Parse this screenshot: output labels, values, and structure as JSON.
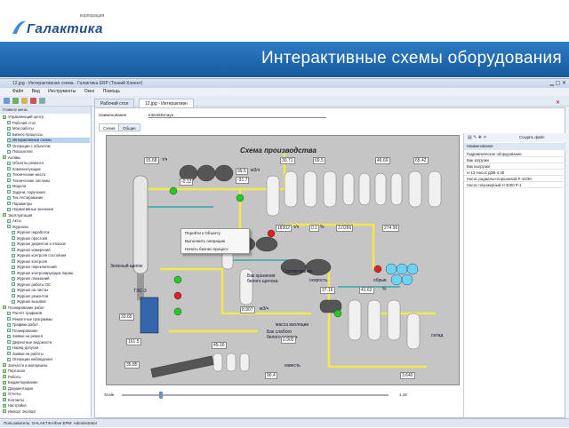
{
  "slide": {
    "logo_word": "Галактика",
    "logo_small": "корпорация",
    "title": "Интерактивные схемы оборудования"
  },
  "window": {
    "title": "12.jpg - Интерактивная схема - Галактика ERP (Тонкий Клиент)",
    "menu": [
      "Файл",
      "Вид",
      "Инструменты",
      "Окно",
      "Помощь"
    ],
    "doc_tabs": [
      "Рабочий стол",
      "12.jpg - Интерактивн"
    ],
    "fields": {
      "name_label": "Наименование",
      "name_value": "Interaktivnaya"
    },
    "sub_tabs": [
      "Схема",
      "Общие"
    ],
    "scale_label": "Scale",
    "scale_value": "1.16",
    "status": "Пользователь: GALAKTIKA\\bve    ЕРМ: Administrator"
  },
  "tree": {
    "header": "Главное меню",
    "items": [
      {
        "label": "Управляющий центр",
        "level": 0,
        "selected": false
      },
      {
        "label": "Рабочий стол",
        "level": 1,
        "selected": false
      },
      {
        "label": "Мои работы",
        "level": 1,
        "selected": false
      },
      {
        "label": "Бизнес-процессы",
        "level": 1,
        "selected": false
      },
      {
        "label": "Интерактивные схемы",
        "level": 1,
        "selected": true
      },
      {
        "label": "Операции с объектом",
        "level": 1,
        "selected": false
      },
      {
        "label": "Показатели",
        "level": 1,
        "selected": false
      },
      {
        "label": "Активы",
        "level": 0,
        "selected": false
      },
      {
        "label": "Объекты ремонта",
        "level": 1,
        "selected": false
      },
      {
        "label": "Комплектующие",
        "level": 1,
        "selected": false
      },
      {
        "label": "Технические места",
        "level": 1,
        "selected": false
      },
      {
        "label": "Технические системы",
        "level": 1,
        "selected": false
      },
      {
        "label": "Модели",
        "level": 1,
        "selected": false
      },
      {
        "label": "Задачи, поручения",
        "level": 1,
        "selected": false
      },
      {
        "label": "Тех.тестирование",
        "level": 1,
        "selected": false
      },
      {
        "label": "Параметры",
        "level": 1,
        "selected": false
      },
      {
        "label": "Нормативные значения",
        "level": 1,
        "selected": false
      },
      {
        "label": "Эксплуатация",
        "level": 0,
        "selected": false
      },
      {
        "label": "Акты",
        "level": 1,
        "selected": false
      },
      {
        "label": "Журналы",
        "level": 1,
        "selected": false
      },
      {
        "label": "Журнал наработок",
        "level": 2,
        "selected": false
      },
      {
        "label": "Журнал простоев",
        "level": 2,
        "selected": false
      },
      {
        "label": "Журнал дефектов и отказов",
        "level": 2,
        "selected": false
      },
      {
        "label": "Журнал измерений",
        "level": 2,
        "selected": false
      },
      {
        "label": "Журнал контроля состояния",
        "level": 2,
        "selected": false
      },
      {
        "label": "Журнал контроля",
        "level": 2,
        "selected": false
      },
      {
        "label": "Журнал переключений",
        "level": 2,
        "selected": false
      },
      {
        "label": "Журнал контролирующих парам.",
        "level": 2,
        "selected": false
      },
      {
        "label": "Журнал показаний",
        "level": 2,
        "selected": false
      },
      {
        "label": "Журнал работы ОС",
        "level": 2,
        "selected": false
      },
      {
        "label": "Журнал на листах",
        "level": 2,
        "selected": false
      },
      {
        "label": "Журнал ремонтов",
        "level": 2,
        "selected": false
      },
      {
        "label": "Журнал вызовов",
        "level": 2,
        "selected": false
      },
      {
        "label": "Планирование работ",
        "level": 0,
        "selected": false
      },
      {
        "label": "Расчёт графиков",
        "level": 1,
        "selected": false
      },
      {
        "label": "Ремонтные программы",
        "level": 1,
        "selected": false
      },
      {
        "label": "Графики работ",
        "level": 1,
        "selected": false
      },
      {
        "label": "Планирование",
        "level": 1,
        "selected": false
      },
      {
        "label": "Заявки на ремонт",
        "level": 1,
        "selected": false
      },
      {
        "label": "Дефектные ведомости",
        "level": 1,
        "selected": false
      },
      {
        "label": "Наряд-допуски",
        "level": 1,
        "selected": false
      },
      {
        "label": "Заявки на работы",
        "level": 1,
        "selected": false
      },
      {
        "label": "Операции наблюдения",
        "level": 1,
        "selected": false
      },
      {
        "label": "Запчасти и материалы",
        "level": 0,
        "selected": false
      },
      {
        "label": "Персонал",
        "level": 0,
        "selected": false
      },
      {
        "label": "Работы",
        "level": 0,
        "selected": false
      },
      {
        "label": "Бюджетирование",
        "level": 0,
        "selected": false
      },
      {
        "label": "Документация",
        "level": 0,
        "selected": false
      },
      {
        "label": "Отчеты",
        "level": 0,
        "selected": false
      },
      {
        "label": "Контакты",
        "level": 0,
        "selected": false
      },
      {
        "label": "Настройка",
        "level": 0,
        "selected": false
      },
      {
        "label": "Импорт Экспорт",
        "level": 0,
        "selected": false
      }
    ]
  },
  "diagram": {
    "title": "Схема производства",
    "labels": [
      "Зеленый щелок",
      "ТЭС-3",
      "Сортирование",
      "скорость",
      "обрыв",
      "Бак хранения белого щелока",
      "Бак слабого белого щелока",
      "склад",
      "масса изоляции",
      "известь"
    ],
    "values": [
      "15.68",
      "-0.12",
      "99.5",
      "-31.7",
      "30.71",
      "69.5",
      "46.69",
      "65.42",
      "18302",
      "0.1",
      "3.0266",
      "274.96",
      "33.65",
      "161.5",
      "8.907",
      "37.16",
      "0.900",
      "41.62",
      "49.16",
      "35.85",
      "90.4",
      "3.640"
    ],
    "units": [
      "т/ч",
      "м3/ч",
      "т/ч",
      "%",
      "м3/ч",
      "%"
    ]
  },
  "context_menu": [
    "Перейти к Объекту",
    "Выполнить операцию",
    "Начать бизнес-процесс"
  ],
  "right_panel": {
    "button": "Создать файл",
    "header": "Наименование",
    "items": [
      "Гидравлическое оборудование",
      "Бак загрузки",
      "Бак выгрузки",
      "Н-13 Насос ДЗВ-4 35",
      "Насос радиальн-поршневой Р-10/30",
      "Насос плунжерный Н-3200 Р-1"
    ]
  },
  "colors": {
    "banner": "#1f6ab3",
    "accent": "#1f4f8a",
    "diagram_bg": "#c5c5c5",
    "flow": "#f4e84a"
  }
}
